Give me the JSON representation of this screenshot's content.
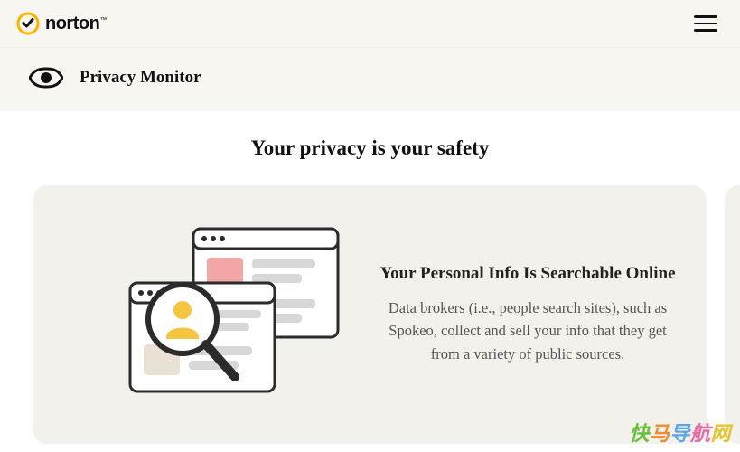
{
  "nav": {
    "brand": "norton",
    "brand_tm": "™"
  },
  "subheader": {
    "title": "Privacy Monitor"
  },
  "main": {
    "tagline": "Your privacy is your safety"
  },
  "cards": [
    {
      "title": "Your Personal Info Is Searchable Online",
      "body": "Data brokers (i.e., people search sites), such as Spokeo, collect and sell your info that they get from a variety of public sources."
    }
  ],
  "watermark": {
    "text": "快马导航网",
    "colors": [
      "#67c23a",
      "#f08c2e",
      "#5aa9e6",
      "#e86aa6",
      "#e7c330"
    ]
  },
  "icons": {
    "eye": "eye-icon",
    "hamburger": "menu-icon",
    "logo_check": "norton-check-icon",
    "illustration": "search-windows-person-icon"
  }
}
